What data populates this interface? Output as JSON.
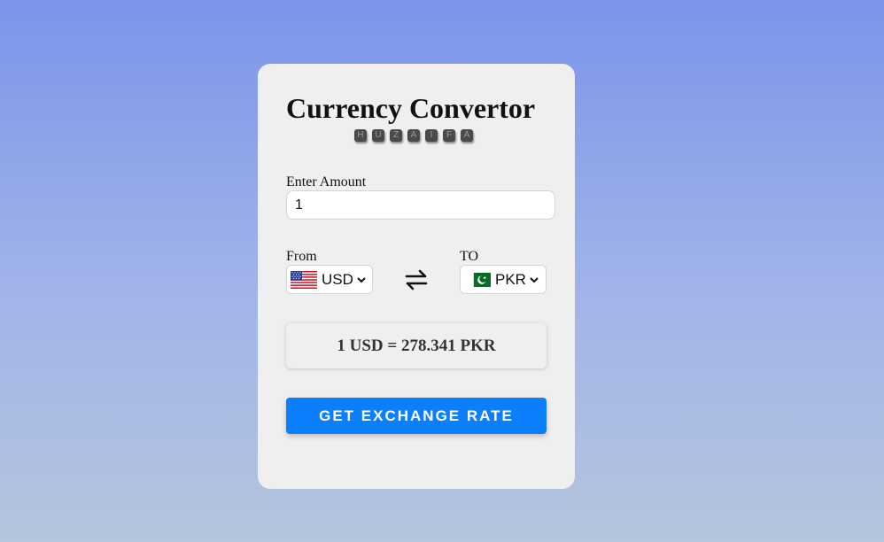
{
  "app": {
    "title": "Currency Convertor",
    "author_letters": [
      "H",
      "U",
      "Z",
      "A",
      "I",
      "F",
      "A"
    ]
  },
  "amount": {
    "label": "Enter Amount",
    "value": "1"
  },
  "from": {
    "label": "From",
    "currency": "USD",
    "flag_icon": "us-flag-icon"
  },
  "to": {
    "label": "TO",
    "currency": "PKR",
    "flag_icon": "pakistan-flag-icon"
  },
  "swap": {
    "icon": "swap-arrows-icon"
  },
  "result": {
    "text": "1 USD = 278.341 PKR"
  },
  "button": {
    "label": "GET EXCHANGE RATE",
    "color": "#0b7ffd"
  }
}
